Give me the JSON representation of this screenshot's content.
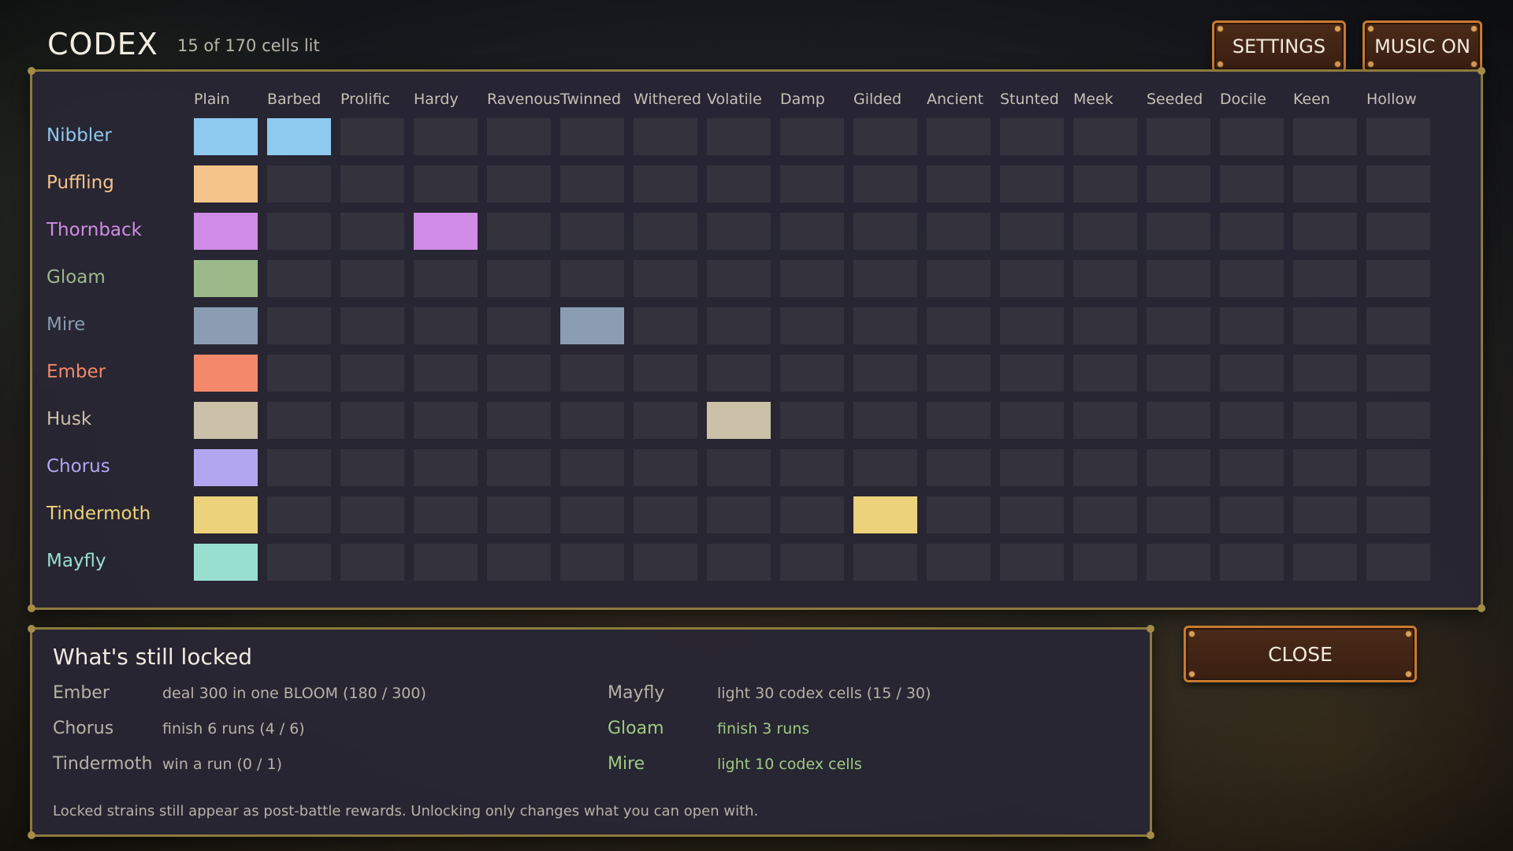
{
  "header": {
    "title": "CODEX",
    "subtitle": "15 of 170 cells lit"
  },
  "buttons": {
    "settings": "SETTINGS",
    "music": "MUSIC ON",
    "close": "CLOSE"
  },
  "grid": {
    "columns": [
      "Plain",
      "Barbed",
      "Prolific",
      "Hardy",
      "Ravenous",
      "Twinned",
      "Withered",
      "Volatile",
      "Damp",
      "Gilded",
      "Ancient",
      "Stunted",
      "Meek",
      "Seeded",
      "Docile",
      "Keen",
      "Hollow"
    ],
    "rows": [
      {
        "label": "Nibbler",
        "color": "#8ec9ef",
        "lit": [
          0,
          1
        ]
      },
      {
        "label": "Puffling",
        "color": "#f5c48a",
        "lit": [
          0
        ]
      },
      {
        "label": "Thornback",
        "color": "#d08ce6",
        "lit": [
          0,
          3
        ]
      },
      {
        "label": "Gloam",
        "color": "#9db98a",
        "lit": [
          0
        ]
      },
      {
        "label": "Mire",
        "color": "#8a9db2",
        "lit": [
          0,
          5
        ]
      },
      {
        "label": "Ember",
        "color": "#f4886a",
        "lit": [
          0
        ]
      },
      {
        "label": "Husk",
        "color": "#cbc0a8",
        "lit": [
          0,
          7
        ]
      },
      {
        "label": "Chorus",
        "color": "#b3a6f1",
        "lit": [
          0
        ]
      },
      {
        "label": "Tindermoth",
        "color": "#ecd27a",
        "lit": [
          0,
          9
        ]
      },
      {
        "label": "Mayfly",
        "color": "#98dfd0",
        "lit": [
          0
        ]
      }
    ],
    "unlit_color": "#33323d"
  },
  "locked": {
    "title": "What's still locked",
    "left": [
      {
        "name": "Ember",
        "requirement": "deal 300 in one BLOOM (180 / 300)",
        "done": false
      },
      {
        "name": "Chorus",
        "requirement": "finish 6 runs (4 / 6)",
        "done": false
      },
      {
        "name": "Tindermoth",
        "requirement": "win a run (0 / 1)",
        "done": false
      }
    ],
    "right": [
      {
        "name": "Mayfly",
        "requirement": "light 30 codex cells (15 / 30)",
        "done": false
      },
      {
        "name": "Gloam",
        "requirement": "finish 3 runs",
        "done": true
      },
      {
        "name": "Mire",
        "requirement": "light 10 codex cells",
        "done": true
      }
    ],
    "footnote": "Locked strains still appear as post-battle rewards. Unlocking only changes what you can open with."
  },
  "colors": {
    "accent": "#c97a2e",
    "panel_border": "#8c7a3e",
    "done_green": "#9fca82"
  }
}
